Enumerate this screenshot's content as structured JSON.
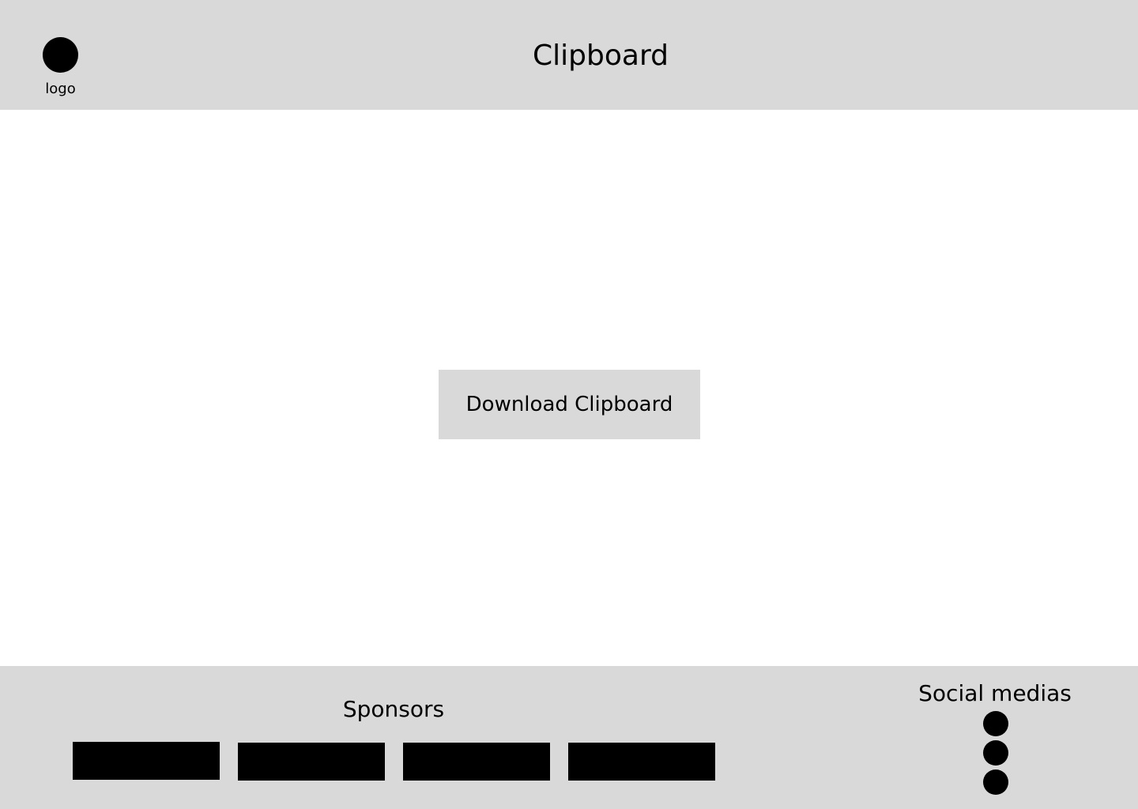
{
  "header": {
    "logo_label": "logo",
    "title": "Clipboard"
  },
  "main": {
    "download_label": "Download Clipboard"
  },
  "footer": {
    "sponsors_title": "Sponsors",
    "sponsors": [
      "sponsor-logo",
      "sponsor-logo",
      "sponsor-logo",
      "sponsor-logo"
    ],
    "social_title": "Social medias",
    "social_icons": [
      "social-icon",
      "social-icon",
      "social-icon"
    ]
  },
  "colors": {
    "panel": "#d9d9d9",
    "background": "#ffffff",
    "placeholder": "#000000"
  }
}
